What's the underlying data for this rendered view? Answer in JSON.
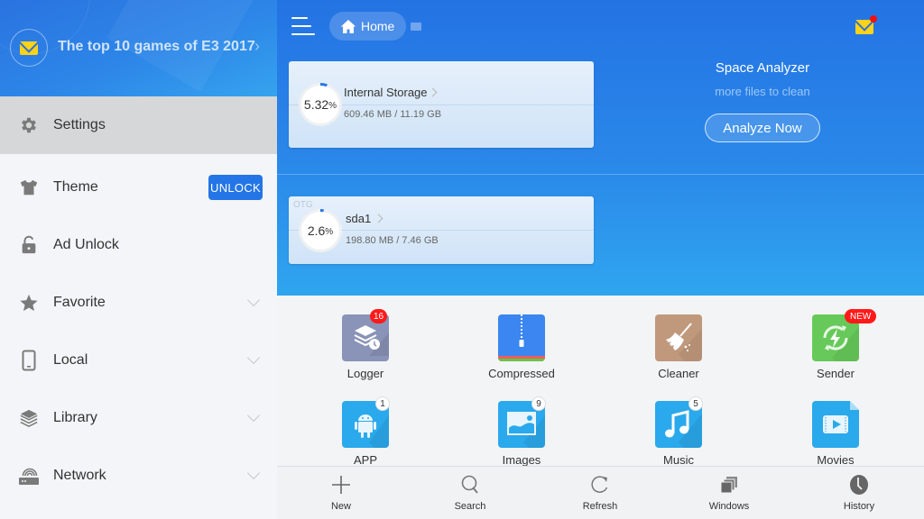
{
  "sidebar": {
    "news": {
      "icon": "mail-icon",
      "title": "The top 10 games of E3 2017"
    },
    "items": [
      {
        "id": "settings",
        "icon": "gear-icon",
        "label": "Settings",
        "active": true
      },
      {
        "id": "theme",
        "icon": "tshirt-icon",
        "label": "Theme",
        "action": "UNLOCK"
      },
      {
        "id": "ad-unlock",
        "icon": "unlock-icon",
        "label": "Ad Unlock"
      },
      {
        "id": "favorite",
        "icon": "star-icon",
        "label": "Favorite",
        "expandable": true
      },
      {
        "id": "local",
        "icon": "phone-icon",
        "label": "Local",
        "expandable": true
      },
      {
        "id": "library",
        "icon": "layers-icon",
        "label": "Library",
        "expandable": true
      },
      {
        "id": "network",
        "icon": "router-icon",
        "label": "Network",
        "expandable": true
      }
    ]
  },
  "header": {
    "breadcrumb": {
      "icon": "home-icon",
      "label": "Home"
    },
    "notification_icon": "mail-icon"
  },
  "storage": [
    {
      "tag": "",
      "name": "Internal Storage",
      "percent": "5.32",
      "percent_unit": "%",
      "used_fraction": 0.0532,
      "size": "609.46 MB / 11.19 GB"
    },
    {
      "tag": "OTG",
      "name": "sda1",
      "percent": "2.6",
      "percent_unit": "%",
      "used_fraction": 0.026,
      "size": "198.80 MB / 7.46 GB"
    }
  ],
  "space_analyzer": {
    "title": "Space Analyzer",
    "subtitle": "more files to clean",
    "button": "Analyze Now"
  },
  "tiles": [
    {
      "id": "logger",
      "label": "Logger",
      "icon": "logger-icon",
      "badge": "16",
      "badge_style": "red",
      "color": "#8a93b8"
    },
    {
      "id": "compressed",
      "label": "Compressed",
      "icon": "zip-icon",
      "badge": "",
      "color": "#3b86f0"
    },
    {
      "id": "cleaner",
      "label": "Cleaner",
      "icon": "broom-icon",
      "badge": "",
      "color": "#c0987c"
    },
    {
      "id": "sender",
      "label": "Sender",
      "icon": "sender-icon",
      "badge": "NEW",
      "badge_style": "red",
      "color": "#66c95a"
    },
    {
      "id": "app",
      "label": "APP",
      "icon": "android-icon",
      "badge": "1",
      "badge_style": "white",
      "color": "#2aa9ec"
    },
    {
      "id": "images",
      "label": "Images",
      "icon": "image-icon",
      "badge": "9",
      "badge_style": "white",
      "color": "#2aa9ec"
    },
    {
      "id": "music",
      "label": "Music",
      "icon": "music-icon",
      "badge": "5",
      "badge_style": "white",
      "color": "#2aa9ec"
    },
    {
      "id": "movies",
      "label": "Movies",
      "icon": "video-icon",
      "badge": "",
      "color": "#2aa9ec"
    }
  ],
  "bottom_nav": [
    {
      "id": "new",
      "label": "New",
      "icon": "plus-icon"
    },
    {
      "id": "search",
      "label": "Search",
      "icon": "search-icon"
    },
    {
      "id": "refresh",
      "label": "Refresh",
      "icon": "refresh-icon"
    },
    {
      "id": "windows",
      "label": "Windows",
      "icon": "windows-icon"
    },
    {
      "id": "history",
      "label": "History",
      "icon": "clock-icon"
    }
  ],
  "colors": {
    "accent": "#2475e6",
    "badge_red": "#ff1a1a",
    "header_gradient_top": "#2473e4",
    "header_gradient_bottom": "#2fa5ef",
    "mail_yellow": "#ffd21a"
  }
}
